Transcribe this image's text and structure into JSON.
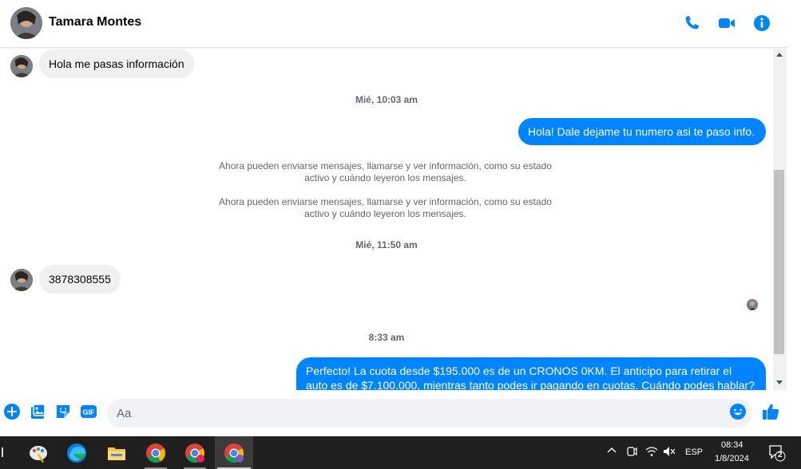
{
  "header": {
    "contact_name": "Tamara Montes",
    "icons": [
      "phone-icon",
      "video-call-icon",
      "info-icon"
    ],
    "accent_color": "#0084ff"
  },
  "messages": [
    {
      "type": "incoming",
      "text": "Hola me pasas información"
    },
    {
      "type": "timestamp",
      "text": "Mié, 10:03 am"
    },
    {
      "type": "outgoing",
      "text": "Hola! Dale dejame tu numero  asi te paso info."
    },
    {
      "type": "system",
      "text": "Ahora pueden enviarse mensajes, llamarse y ver información, como su estado activo y cuándo leyeron los mensajes."
    },
    {
      "type": "system",
      "text": "Ahora pueden enviarse mensajes, llamarse y ver información, como su estado activo y cuándo leyeron los mensajes."
    },
    {
      "type": "timestamp",
      "text": "Mié, 11:50 am"
    },
    {
      "type": "incoming",
      "text": "3878308555"
    },
    {
      "type": "timestamp",
      "text": "8:33 am"
    },
    {
      "type": "outgoing",
      "text": "Perfecto! La cuota desde $195.000 es de un CRONOS 0KM. El anticipo para retirar el auto es de $7.100.000, mientras tanto podes ir pagando en cuotas. Cuándo podes hablar? A la"
    }
  ],
  "composer": {
    "placeholder": "Aa",
    "icons": [
      "add-icon",
      "image-icon",
      "sticker-icon",
      "gif-icon",
      "emoji-icon",
      "like-icon"
    ],
    "gif_label": "GIF"
  },
  "taskbar": {
    "apps": [
      "paint-icon",
      "edge-icon",
      "file-explorer-icon",
      "chrome-icon",
      "chrome-profile-icon",
      "chrome-incognito-icon"
    ],
    "language": "ESP",
    "time": "08:34",
    "date": "1/8/2024",
    "notification_count": "2"
  }
}
